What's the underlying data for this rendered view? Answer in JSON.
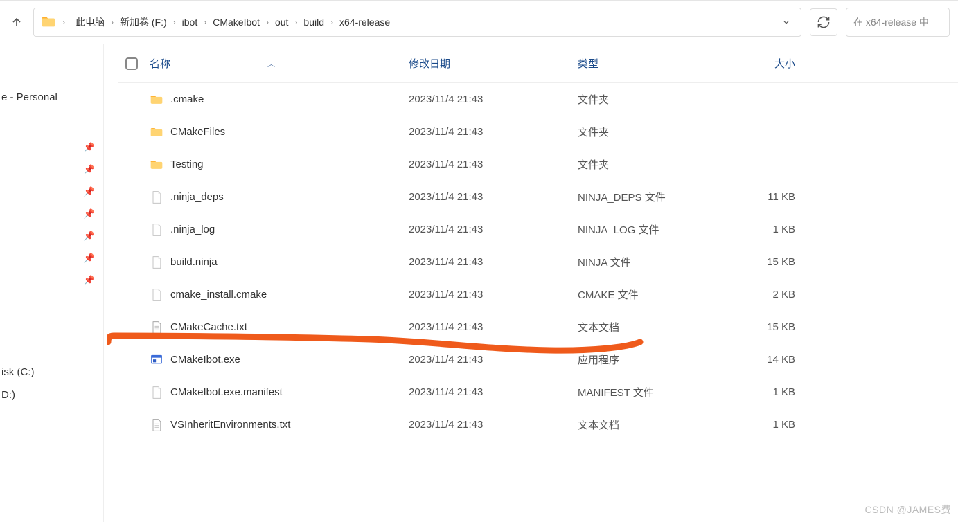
{
  "nav": {
    "breadcrumbs": [
      "此电脑",
      "新加卷 (F:)",
      "ibot",
      "CMakeIbot",
      "out",
      "build",
      "x64-release"
    ],
    "search_placeholder": "在 x64-release 中"
  },
  "columns": {
    "name": "名称",
    "date": "修改日期",
    "type": "类型",
    "size": "大小"
  },
  "sidebar": {
    "personal": "e - Personal",
    "disk_c": "isk (C:)",
    "disk_d": "D:)"
  },
  "files": [
    {
      "icon": "folder",
      "name": ".cmake",
      "date": "2023/11/4 21:43",
      "type": "文件夹",
      "size": ""
    },
    {
      "icon": "folder",
      "name": "CMakeFiles",
      "date": "2023/11/4 21:43",
      "type": "文件夹",
      "size": ""
    },
    {
      "icon": "folder",
      "name": "Testing",
      "date": "2023/11/4 21:43",
      "type": "文件夹",
      "size": ""
    },
    {
      "icon": "file",
      "name": ".ninja_deps",
      "date": "2023/11/4 21:43",
      "type": "NINJA_DEPS 文件",
      "size": "11 KB"
    },
    {
      "icon": "file",
      "name": ".ninja_log",
      "date": "2023/11/4 21:43",
      "type": "NINJA_LOG 文件",
      "size": "1 KB"
    },
    {
      "icon": "file",
      "name": "build.ninja",
      "date": "2023/11/4 21:43",
      "type": "NINJA 文件",
      "size": "15 KB"
    },
    {
      "icon": "file",
      "name": "cmake_install.cmake",
      "date": "2023/11/4 21:43",
      "type": "CMAKE 文件",
      "size": "2 KB"
    },
    {
      "icon": "txt",
      "name": "CMakeCache.txt",
      "date": "2023/11/4 21:43",
      "type": "文本文档",
      "size": "15 KB"
    },
    {
      "icon": "exe",
      "name": "CMakeIbot.exe",
      "date": "2023/11/4 21:43",
      "type": "应用程序",
      "size": "14 KB"
    },
    {
      "icon": "file",
      "name": "CMakeIbot.exe.manifest",
      "date": "2023/11/4 21:43",
      "type": "MANIFEST 文件",
      "size": "1 KB"
    },
    {
      "icon": "txt",
      "name": "VSInheritEnvironments.txt",
      "date": "2023/11/4 21:43",
      "type": "文本文档",
      "size": "1 KB"
    }
  ],
  "watermark": "CSDN @JAMES费"
}
